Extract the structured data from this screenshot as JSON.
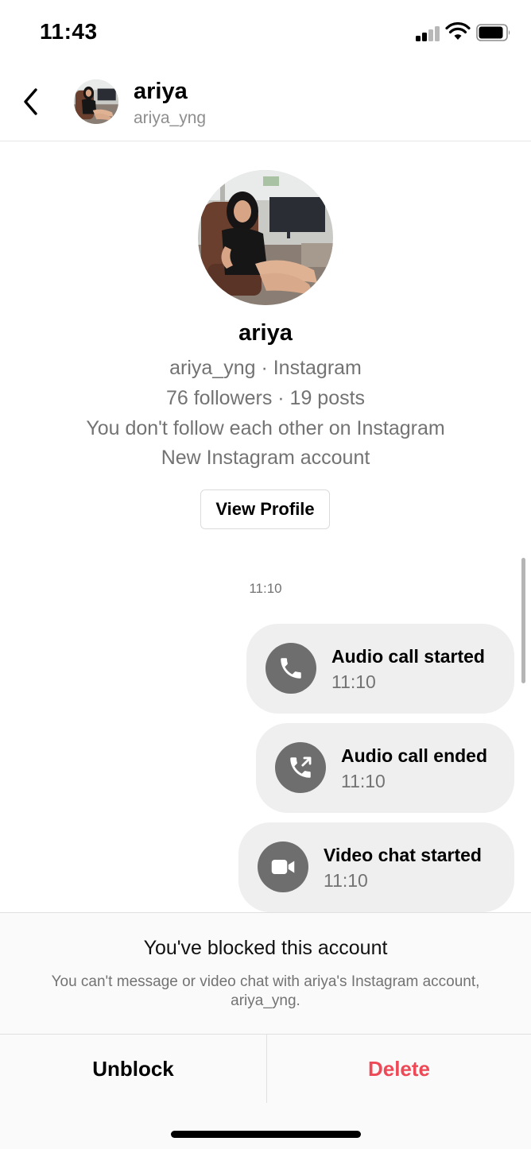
{
  "status_bar": {
    "time": "11:43",
    "icons": [
      "cellular-signal-icon",
      "wifi-icon",
      "battery-icon"
    ]
  },
  "header": {
    "name": "ariya",
    "handle": "ariya_yng",
    "icons": [
      "back-chevron-icon",
      "avatar"
    ]
  },
  "profile": {
    "name": "ariya",
    "subtitle": "ariya_yng · Instagram",
    "stats": "76 followers · 19 posts",
    "follow_status": "You don't follow each other on Instagram",
    "account_note": "New Instagram account",
    "view_profile_label": "View Profile"
  },
  "chat": {
    "timestamp": "11:10",
    "messages": [
      {
        "title": "Audio call started",
        "time": "11:10",
        "icon": "phone-icon"
      },
      {
        "title": "Audio call ended",
        "time": "11:10",
        "icon": "phone-ended-icon"
      },
      {
        "title": "Video chat started",
        "time": "11:10",
        "icon": "video-camera-icon"
      }
    ]
  },
  "blocked": {
    "title": "You've blocked this account",
    "description": "You can't message or video chat with ariya's Instagram account, ariya_yng.",
    "unblock_label": "Unblock",
    "delete_label": "Delete"
  },
  "colors": {
    "delete_red": "#ed4956",
    "bubble_bg": "#efefef",
    "secondary_text": "#737373",
    "call_icon_bg": "#6e6e6e"
  }
}
